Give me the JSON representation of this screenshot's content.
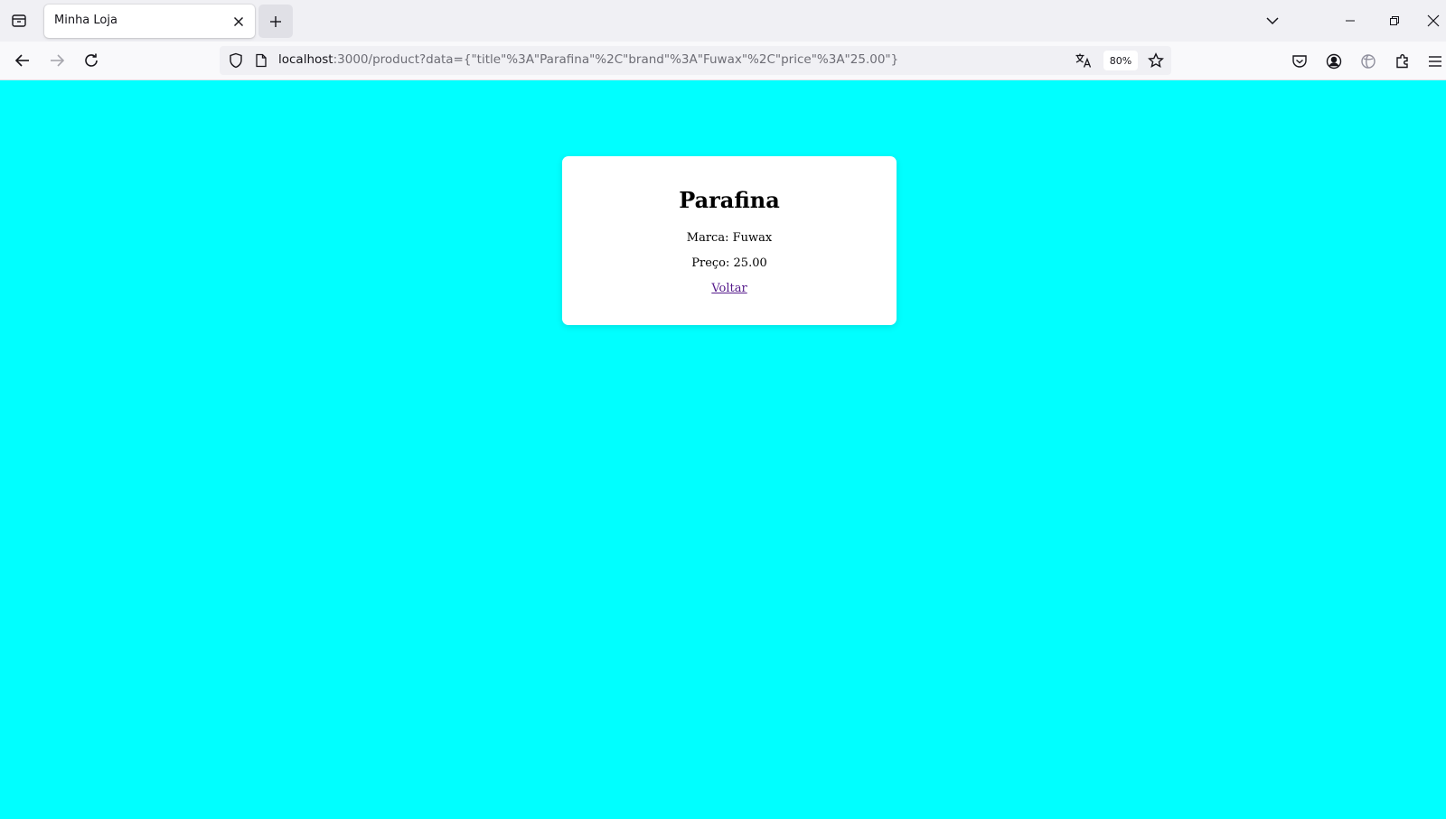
{
  "browser": {
    "tab": {
      "title": "Minha Loja"
    },
    "url": {
      "host": "localhost",
      "rest": ":3000/product?data={\"title\"%3A\"Parafina\"%2C\"brand\"%3A\"Fuwax\"%2C\"price\"%3A\"25.00\"}"
    },
    "zoom": "80%"
  },
  "product": {
    "title": "Parafina",
    "brand_line": "Marca: Fuwax",
    "price_line": "Preço: 25.00",
    "back_label": "Voltar"
  },
  "colors": {
    "page_background": "#00ffff",
    "card_background": "#ffffff",
    "visited_link": "#551a8b"
  }
}
